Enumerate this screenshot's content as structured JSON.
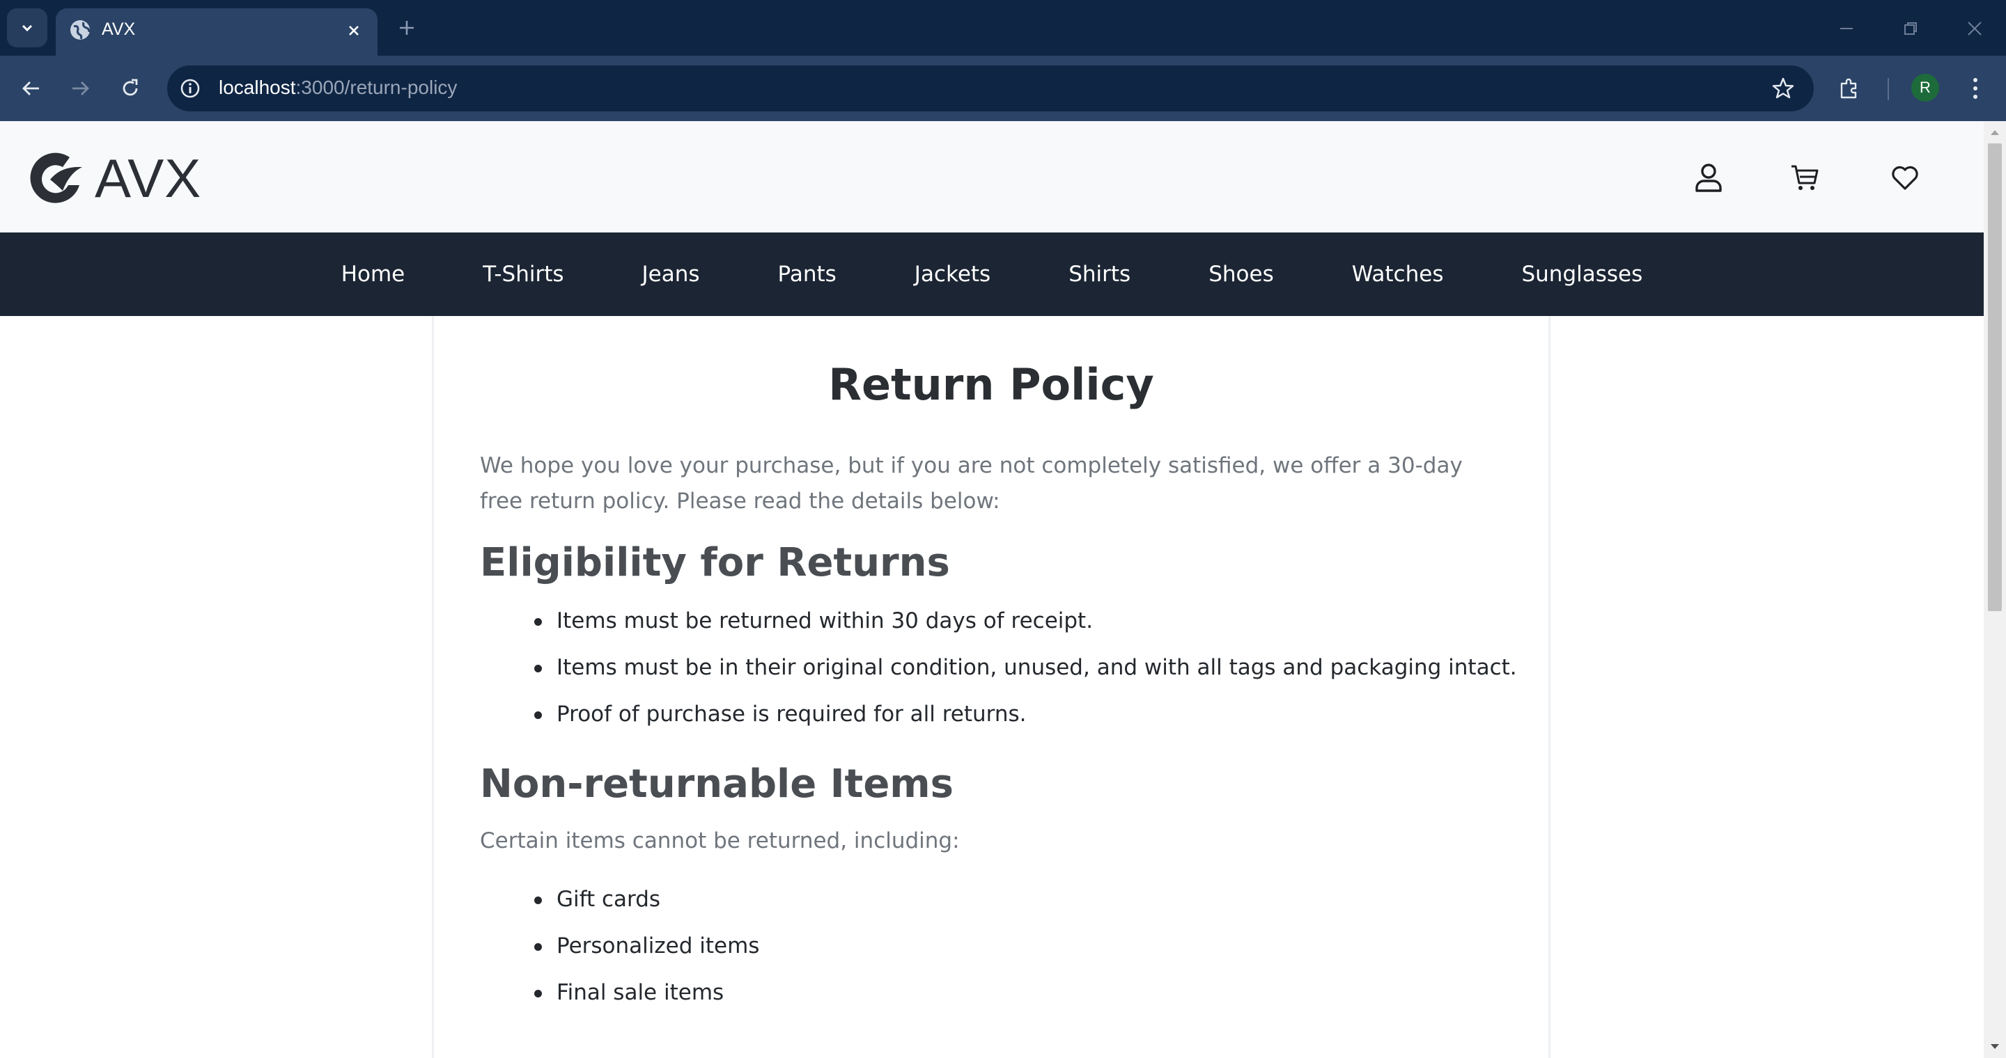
{
  "browser": {
    "tab_title": "AVX",
    "url_host": "localhost",
    "url_path": ":3000/return-policy",
    "profile_initial": "R"
  },
  "site": {
    "logo_text": "AVX",
    "nav": [
      "Home",
      "T-Shirts",
      "Jeans",
      "Pants",
      "Jackets",
      "Shirts",
      "Shoes",
      "Watches",
      "Sunglasses"
    ]
  },
  "page": {
    "title": "Return Policy",
    "intro": "We hope you love your purchase, but if you are not completely satisfied, we offer a 30-day free return policy. Please read the details below:",
    "eligibility": {
      "heading": "Eligibility for Returns",
      "items": [
        "Items must be returned within 30 days of receipt.",
        "Items must be in their original condition, unused, and with all tags and packaging intact.",
        "Proof of purchase is required for all returns."
      ]
    },
    "non_returnable": {
      "heading": "Non-returnable Items",
      "intro": "Certain items cannot be returned, including:",
      "items": [
        "Gift cards",
        "Personalized items",
        "Final sale items"
      ]
    }
  },
  "colors": {
    "tabbar": "#0f2544",
    "toolbar": "#2a4366",
    "nav_bg": "#1c2533",
    "header_bg": "#f7f9fb"
  }
}
